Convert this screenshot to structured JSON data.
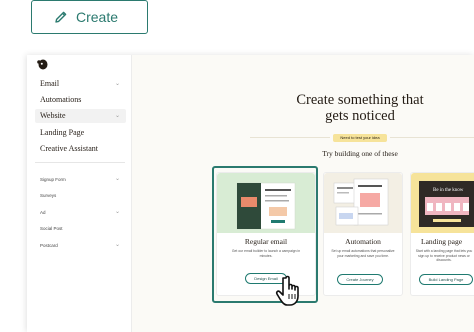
{
  "create_button": {
    "label": "Create",
    "icon": "pencil-icon",
    "color": "#2b7a6f"
  },
  "sidebar": {
    "logo": "mailchimp-logo-icon",
    "items": [
      {
        "label": "Email",
        "chevron": true
      },
      {
        "label": "Automations",
        "chevron": false
      },
      {
        "label": "Website",
        "chevron": true,
        "active": true
      },
      {
        "label": "Landing Page",
        "chevron": false
      },
      {
        "label": "Creative Assistant",
        "chevron": false
      }
    ],
    "sub_items": [
      {
        "label": "Signup Form",
        "chevron": true
      },
      {
        "label": "Surveys",
        "chevron": false
      },
      {
        "label": "Ad",
        "chevron": true
      },
      {
        "label": "Social Post",
        "chevron": false
      },
      {
        "label": "Postcard",
        "chevron": true
      }
    ]
  },
  "main": {
    "title_line1": "Create something that",
    "title_line2": "gets noticed",
    "beta_label": "Need to test your idea",
    "subtitle": "Try building one of these",
    "cards": [
      {
        "title": "Regular email",
        "description": "Get our email builder to launch a campaign in minutes.",
        "button": "Design Email",
        "top_color": "#d8ecd4"
      },
      {
        "title": "Automation",
        "description": "Set up email automations that personalize your marketing and save you time.",
        "button": "Create Journey",
        "top_color": "#f3efe4"
      },
      {
        "title": "Landing page",
        "description": "Start with a landing page that lets you sign up to receive product news or discounts.",
        "button": "Build Landing Page",
        "top_color": "#f6e39a"
      }
    ],
    "card3_banner": "Be in the know"
  },
  "colors": {
    "accent": "#2b7a6f",
    "background": "#fbfaf6",
    "text": "#241c15"
  }
}
